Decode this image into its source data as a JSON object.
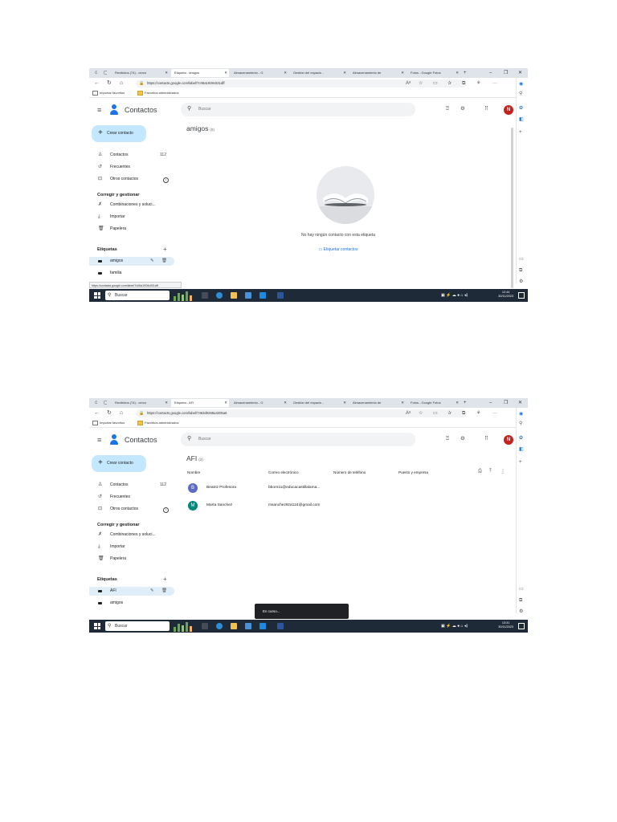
{
  "shot1": {
    "tabs": [
      {
        "label": "Recibidos (74) - cerco",
        "icon": "mail-icon"
      },
      {
        "label": "Etiqueta - amigos",
        "icon": "contacts-icon"
      },
      {
        "label": "Almacenamiento - G",
        "icon": "drive-icon"
      },
      {
        "label": "Gestión del espacio -",
        "icon": "page-icon"
      },
      {
        "label": "Almacenamiento de",
        "icon": "page-icon"
      },
      {
        "label": "Fotos - Google Fotos",
        "icon": "photos-icon"
      }
    ],
    "new_tab": "+",
    "url": "https://contacts.google.com/label/7c06a1928c531dff",
    "favorites": {
      "import": "Importar favoritos",
      "folder": "Favoritos administrados"
    },
    "app_title": "Contactos",
    "search_placeholder": "Buscar",
    "avatar_letter": "N",
    "create_label": "Crear contacto",
    "nav": {
      "contacts": "Contactos",
      "contacts_count": "112",
      "frequent": "Frecuentes",
      "other": "Otros contactos",
      "fix_heading": "Corregir y gestionar",
      "merge": "Combinaciones y soluci...",
      "import": "Importar",
      "trash": "Papelera",
      "labels_heading": "Etiquetas"
    },
    "labels": [
      "amigos",
      "familia"
    ],
    "page_title": "amigos",
    "page_count": "(0)",
    "empty_message": "No hay ningún contacto con esta etiqueta",
    "empty_link": "Etiquetar contactos",
    "status_url": "https://contacts.google.com/label/7c06a1928c531dff",
    "taskbar": {
      "search": "Buscar",
      "time": "12:44",
      "date": "30/11/2023"
    }
  },
  "shot2": {
    "tabs": [
      {
        "label": "Recibidos (74) - cerco",
        "icon": "mail-icon"
      },
      {
        "label": "Etiqueta - AFI",
        "icon": "contacts-icon"
      },
      {
        "label": "Almacenamiento - G",
        "icon": "drive-icon"
      },
      {
        "label": "Gestión del espacio -",
        "icon": "page-icon"
      },
      {
        "label": "Almacenamiento de",
        "icon": "page-icon"
      },
      {
        "label": "Fotos - Google Fotos",
        "icon": "photos-icon"
      }
    ],
    "new_tab": "+",
    "url": "https://contacts.google.com/label/7463d0268a3205a6",
    "favorites": {
      "import": "Importar favoritos",
      "folder": "Favoritos administrados"
    },
    "app_title": "Contactos",
    "search_placeholder": "Buscar",
    "avatar_letter": "N",
    "create_label": "Crear contacto",
    "nav": {
      "contacts": "Contactos",
      "contacts_count": "112",
      "frequent": "Frecuentes",
      "other": "Otros contactos",
      "fix_heading": "Corregir y gestionar",
      "merge": "Combinaciones y soluci...",
      "import": "Importar",
      "trash": "Papelera",
      "labels_heading": "Etiquetas"
    },
    "labels": [
      "AFI",
      "amigos"
    ],
    "page_title": "AFI",
    "page_count": "(2)",
    "columns": [
      "Nombre",
      "Correo electrónico",
      "Número de teléfono",
      "Puesto y empresa"
    ],
    "contacts": [
      {
        "initial": "B",
        "name": "Beatriz Profesora",
        "email": "bborn11@educacastillalama...",
        "color": "#5c6bc0"
      },
      {
        "initial": "M",
        "name": "Marta Sanchez",
        "email": "msanchez8za124@gmail.com",
        "color": "#00897b"
      }
    ],
    "toast": "En curso...",
    "taskbar": {
      "search": "Buscar",
      "time": "13:31",
      "date": "30/11/2023"
    }
  }
}
